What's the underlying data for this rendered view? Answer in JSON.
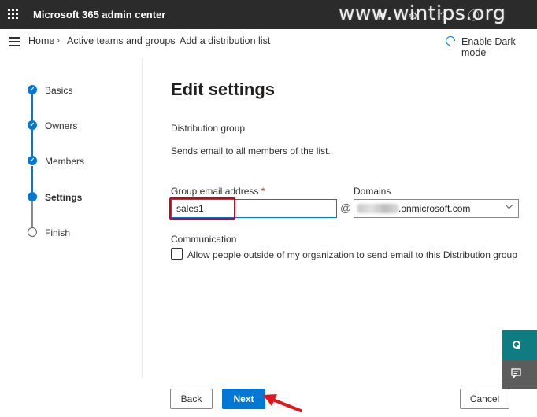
{
  "app": {
    "title": "Microsoft 365 admin center"
  },
  "watermark": "www.wintips.org",
  "breadcrumb": {
    "items": [
      "Home",
      "Active teams and groups",
      "Add a distribution list"
    ]
  },
  "dark_mode_label": "Enable Dark mode",
  "steps": [
    {
      "label": "Basics",
      "state": "done"
    },
    {
      "label": "Owners",
      "state": "done"
    },
    {
      "label": "Members",
      "state": "done"
    },
    {
      "label": "Settings",
      "state": "current"
    },
    {
      "label": "Finish",
      "state": "todo"
    }
  ],
  "form": {
    "title": "Edit settings",
    "group_type_label": "Distribution group",
    "group_type_desc": "Sends email to all members of the list.",
    "email_label": "Group email address",
    "required_mark": "*",
    "email_value": "sales1",
    "at": "@",
    "domains_label": "Domains",
    "domain_value": ".onmicrosoft.com",
    "communication_label": "Communication",
    "checkbox_label": "Allow people outside of my organization to send email to this Distribution group",
    "checkbox_checked": false
  },
  "footer": {
    "back": "Back",
    "next": "Next",
    "cancel": "Cancel"
  },
  "colors": {
    "accent": "#0078d4",
    "topbar": "#2b2b2b",
    "highlight": "#d0021b",
    "help_button": "#0f7c81"
  }
}
